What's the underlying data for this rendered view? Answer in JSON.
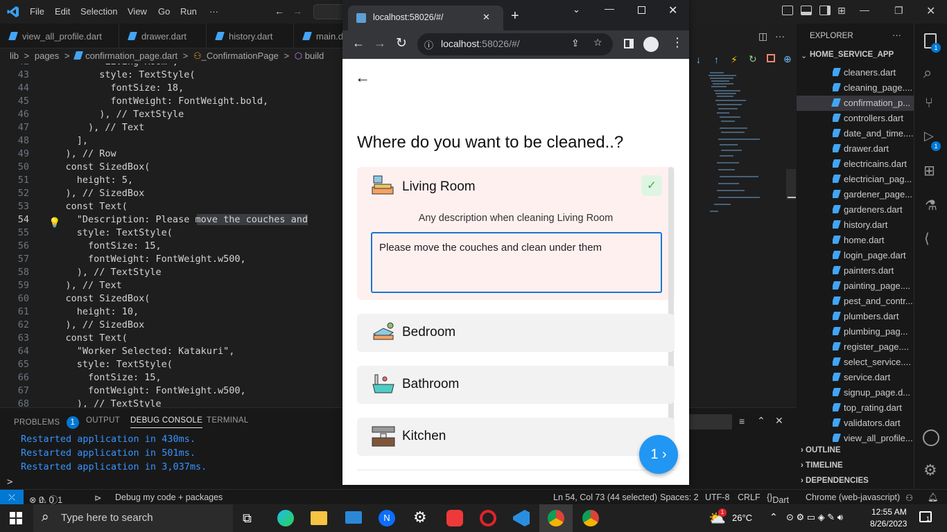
{
  "vscode": {
    "menu": [
      "File",
      "Edit",
      "Selection",
      "View",
      "Go",
      "Run",
      "···"
    ],
    "tabs": [
      "view_all_profile.dart",
      "drawer.dart",
      "history.dart",
      "main.d"
    ],
    "breadcrumb": {
      "parts": [
        "lib",
        "pages",
        "confirmation_page.dart",
        "_ConfirmationPage",
        "build"
      ],
      "sep": ">"
    },
    "editor": {
      "current_line": 54,
      "lines": [
        {
          "n": "42",
          "text": "          \"Living Room\","
        },
        {
          "n": "43",
          "text": "          style: TextStyle("
        },
        {
          "n": "44",
          "text": "            fontSize: 18,"
        },
        {
          "n": "45",
          "text": "            fontWeight: FontWeight.bold,"
        },
        {
          "n": "46",
          "text": "          ), // TextStyle"
        },
        {
          "n": "47",
          "text": "        ), // Text"
        },
        {
          "n": "48",
          "text": "      ],"
        },
        {
          "n": "49",
          "text": "    ), // Row"
        },
        {
          "n": "50",
          "text": "    const SizedBox("
        },
        {
          "n": "51",
          "text": "      height: 5,"
        },
        {
          "n": "52",
          "text": "    ), // SizedBox"
        },
        {
          "n": "53",
          "text": "    const Text("
        },
        {
          "n": "54",
          "text": "      \"Description: Please move the couches and"
        },
        {
          "n": "55",
          "text": "      style: TextStyle("
        },
        {
          "n": "56",
          "text": "        fontSize: 15,"
        },
        {
          "n": "57",
          "text": "        fontWeight: FontWeight.w500,"
        },
        {
          "n": "58",
          "text": "      ), // TextStyle"
        },
        {
          "n": "59",
          "text": "    ), // Text"
        },
        {
          "n": "60",
          "text": "    const SizedBox("
        },
        {
          "n": "61",
          "text": "      height: 10,"
        },
        {
          "n": "62",
          "text": "    ), // SizedBox"
        },
        {
          "n": "63",
          "text": "    const Text("
        },
        {
          "n": "64",
          "text": "      \"Worker Selected: Katakuri\","
        },
        {
          "n": "65",
          "text": "      style: TextStyle("
        },
        {
          "n": "66",
          "text": "        fontSize: 15,"
        },
        {
          "n": "67",
          "text": "        fontWeight: FontWeight.w500,"
        },
        {
          "n": "68",
          "text": "      ), // TextStyle"
        }
      ]
    },
    "panel": {
      "tabs": [
        "PROBLEMS",
        "OUTPUT",
        "DEBUG CONSOLE",
        "TERMINAL"
      ],
      "problems_count": "1",
      "active_tab": "DEBUG CONSOLE",
      "output": [
        "Restarted application in 430ms.",
        "Restarted application in 501ms.",
        "Restarted application in 3,037ms."
      ],
      "prompt": ">"
    },
    "explorer": {
      "title": "EXPLORER",
      "project": "HOME_SERVICE_APP",
      "files": [
        "cleaners.dart",
        "cleaning_page....",
        "confirmation_p...",
        "controllers.dart",
        "date_and_time....",
        "drawer.dart",
        "electricains.dart",
        "electrician_pag...",
        "gardener_page....",
        "gardeners.dart",
        "history.dart",
        "home.dart",
        "login_page.dart",
        "painters.dart",
        "painting_page....",
        "pest_and_contr...",
        "plumbers.dart",
        "plumbing_pag...",
        "register_page....",
        "select_service....",
        "service.dart",
        "signup_page.d...",
        "top_rating.dart",
        "validators.dart",
        "view_all_profile..."
      ],
      "selected_index": 2,
      "sections": [
        "OUTLINE",
        "TIMELINE",
        "DEPENDENCIES"
      ]
    },
    "activity_badges": {
      "explorer": "1",
      "debug": "1"
    },
    "statusbar": {
      "errors": "0",
      "warnings": "0",
      "info": "1",
      "debug": "Debug my code + packages",
      "position": "Ln 54, Col 73 (44 selected)",
      "spaces": "Spaces: 2",
      "encoding": "UTF-8",
      "eol": "CRLF",
      "language": "Dart",
      "device": "Chrome (web-javascript)"
    }
  },
  "chrome": {
    "tab_title": "localhost:58026/#/",
    "url_host": "localhost",
    "url_rest": ":58026/#/"
  },
  "app": {
    "heading": "Where do you want to be cleaned..?",
    "rooms": [
      {
        "name": "Living Room",
        "selected": true
      },
      {
        "name": "Bedroom",
        "selected": false
      },
      {
        "name": "Bathroom",
        "selected": false
      },
      {
        "name": "Kitchen",
        "selected": false
      }
    ],
    "description_label": "Any description when cleaning Living Room",
    "description_value": "Please move the couches and clean under them",
    "accent": "#2196f3",
    "selected_bg": "#fff0f0"
  },
  "taskbar": {
    "search_placeholder": "Type here to search",
    "weather": "26°C",
    "weather_badge": "1",
    "time": "12:55 AM",
    "date": "8/26/2023",
    "notifications": "1"
  }
}
